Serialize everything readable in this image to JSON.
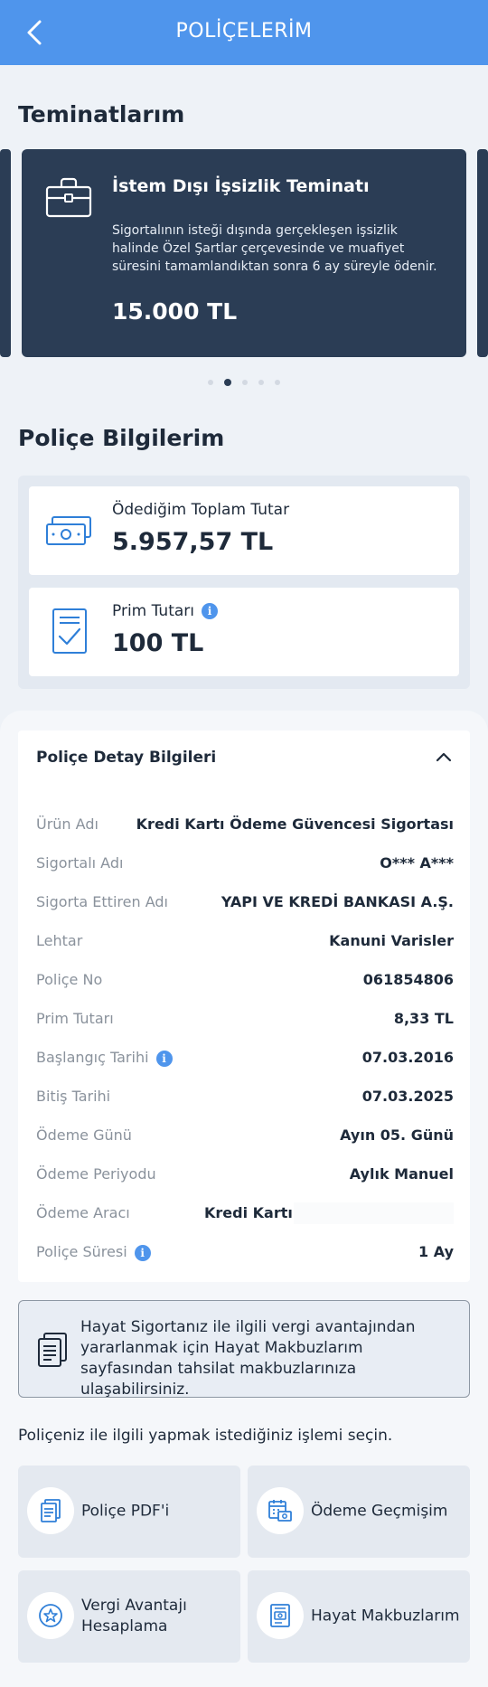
{
  "header": {
    "title": "POLİÇELERİM",
    "back_icon": "chevron-left-icon"
  },
  "coverages": {
    "heading": "Teminatlarım",
    "card": {
      "icon": "briefcase-icon",
      "title": "İstem Dışı İşsizlik Teminatı",
      "description": "Sigortalının isteği dışında gerçekleşen işsizlik halinde Özel Şartlar çerçevesinde ve muafiyet süresini tamamlandıktan sonra 6 ay süreyle ödenir.",
      "amount": "15.000 TL"
    },
    "carousel": {
      "count": 5,
      "active": 2
    }
  },
  "policy_info": {
    "heading": "Poliçe Bilgilerim",
    "total_paid": {
      "label": "Ödediğim Toplam Tutar",
      "value": "5.957,57 TL",
      "icon": "money-icon"
    },
    "premium": {
      "label": "Prim Tutarı",
      "value": "100 TL",
      "icon": "document-check-icon"
    }
  },
  "details": {
    "heading": "Poliçe Detay Bilgileri",
    "rows": [
      {
        "key": "Ürün Adı",
        "value": "Kredi Kartı Ödeme Güvencesi Sigortası"
      },
      {
        "key": "Sigortalı Adı",
        "value": "O*** A***"
      },
      {
        "key": "Sigorta Ettiren Adı",
        "value": "YAPI VE KREDİ BANKASI A.Ş."
      },
      {
        "key": "Lehtar",
        "value": "Kanuni Varisler"
      },
      {
        "key": "Poliçe No",
        "value": "061854806"
      },
      {
        "key": "Prim Tutarı",
        "value": "8,33 TL"
      },
      {
        "key": "Başlangıç Tarihi",
        "value": "07.03.2016"
      },
      {
        "key": "Bitiş Tarihi",
        "value": "07.03.2025"
      },
      {
        "key": "Ödeme Günü",
        "value": "Ayın 05. Günü"
      },
      {
        "key": "Ödeme Periyodu",
        "value": "Aylık Manuel"
      },
      {
        "key": "Ödeme Aracı",
        "value": "Kredi Kartı -"
      },
      {
        "key": "Poliçe Süresi",
        "value": "1 Ay"
      }
    ]
  },
  "notice": {
    "icon": "receipt-document-icon",
    "text": "Hayat Sigortanız ile ilgili vergi avantajından yararlanmak için Hayat Makbuzlarım sayfasından tahsilat makbuzlarınıza ulaşabilirsiniz."
  },
  "actions": {
    "prompt": "Poliçeniz ile ilgili yapmak istediğiniz işlemi seçin.",
    "items": [
      {
        "label": "Poliçe PDF'i",
        "icon": "pdf-document-icon"
      },
      {
        "label": "Ödeme Geçmişim",
        "icon": "calendar-money-icon"
      },
      {
        "label": "Vergi Avantajı Hesaplama",
        "icon": "star-badge-icon"
      },
      {
        "label": "Hayat Makbuzlarım",
        "icon": "receipt-icon"
      }
    ]
  },
  "colors": {
    "header": "#4f95ec",
    "card_dark": "#2b3d55",
    "info_icon": "#4f95ec",
    "accent_icon": "#2f7fd8"
  }
}
